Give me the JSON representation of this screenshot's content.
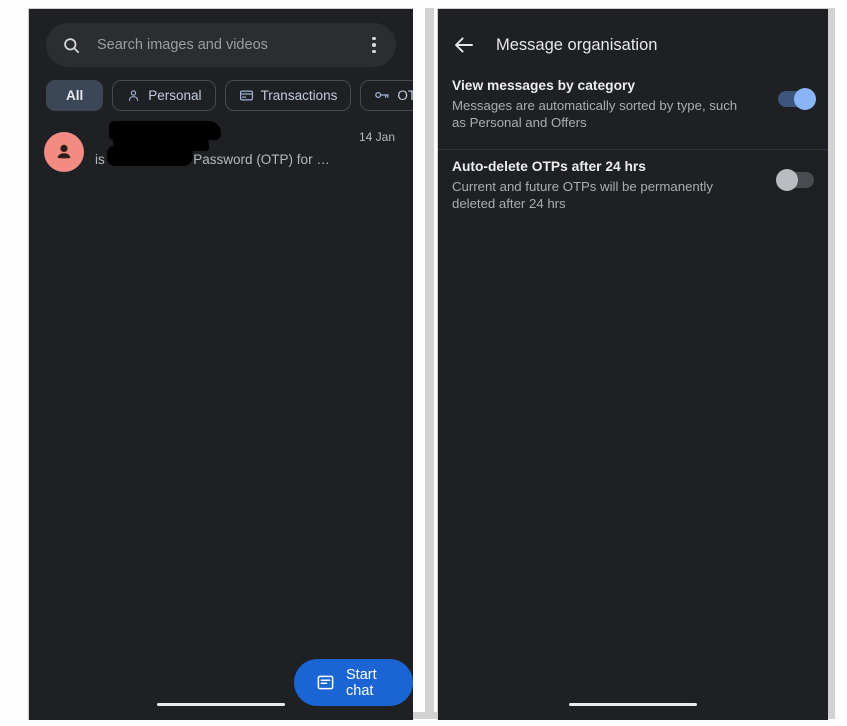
{
  "left_panel": {
    "search": {
      "placeholder": "Search images and videos",
      "value": "",
      "icon": "search-icon",
      "overflow_icon": "kebab-menu-icon"
    },
    "chips": [
      {
        "label": "All",
        "icon": null,
        "selected": true
      },
      {
        "label": "Personal",
        "icon": "person-icon",
        "selected": false
      },
      {
        "label": "Transactions",
        "icon": "credit-card-icon",
        "selected": false
      },
      {
        "label": "OTPs",
        "icon": "key-icon",
        "selected": false
      },
      {
        "label": "",
        "icon": "tag-icon",
        "selected": false
      }
    ],
    "messages": [
      {
        "sender": "",
        "preview": "is the One Time Password (OTP) for …",
        "date": "14 Jan",
        "avatar_color": "#f28b82",
        "redacted": true
      }
    ],
    "fab": {
      "label": "Start chat",
      "icon": "chat-message-icon",
      "color": "#1a64d4"
    }
  },
  "right_panel": {
    "header": {
      "title": "Message organisation",
      "back_icon": "back-arrow-icon"
    },
    "settings": [
      {
        "title": "View messages by category",
        "description": "Messages are automatically sorted by type, such as Personal and Offers",
        "toggle_state": "on",
        "toggle_color": "#8ab4f8"
      },
      {
        "title": "Auto-delete OTPs after 24 hrs",
        "description": "Current and future OTPs will be permanently deleted after 24 hrs",
        "toggle_state": "off",
        "toggle_color": "#b9bcc0"
      }
    ]
  }
}
